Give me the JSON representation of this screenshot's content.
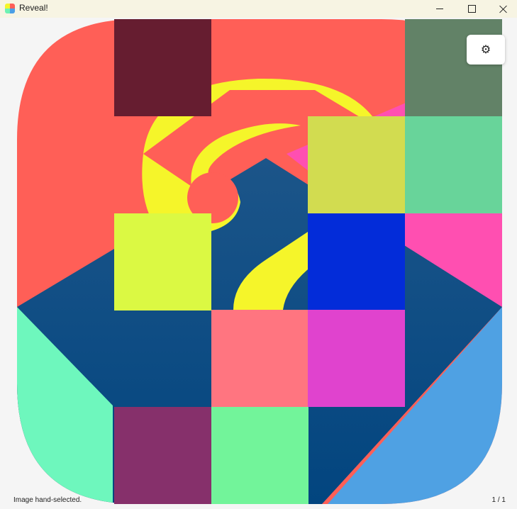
{
  "window": {
    "title": "Reveal!",
    "minimize_glyph": "—",
    "maximize_glyph": "☐",
    "close_glyph": "✕"
  },
  "toolbar": {
    "settings_icon": "gear-icon",
    "settings_glyph": "⚙"
  },
  "status": {
    "left_text": "Image hand-selected.",
    "right_text": "1 / 1"
  },
  "puzzle": {
    "grid": "5x5",
    "hidden_image": "question-mark",
    "tiles": [
      {
        "row": 0,
        "col": 1,
        "color": "#661d30"
      },
      {
        "row": 0,
        "col": 4,
        "color": "#628267"
      },
      {
        "row": 1,
        "col": 3,
        "color": "#d2dc50"
      },
      {
        "row": 1,
        "col": 4,
        "color": "#68d49a"
      },
      {
        "row": 2,
        "col": 1,
        "color": "#dbf943"
      },
      {
        "row": 2,
        "col": 3,
        "color": "#032cd9"
      },
      {
        "row": 3,
        "col": 2,
        "color": "#ff7580"
      },
      {
        "row": 3,
        "col": 3,
        "color": "#e043ce"
      },
      {
        "row": 4,
        "col": 1,
        "color": "#86306b"
      },
      {
        "row": 4,
        "col": 2,
        "color": "#72f49a"
      }
    ],
    "colors": {
      "coral": "#ff5f57",
      "pink": "#ff4fb1",
      "navy": "#05467f",
      "mint": "#6ef7bd",
      "sky": "#4fa1e3",
      "yellow": "#f5f52a"
    }
  }
}
